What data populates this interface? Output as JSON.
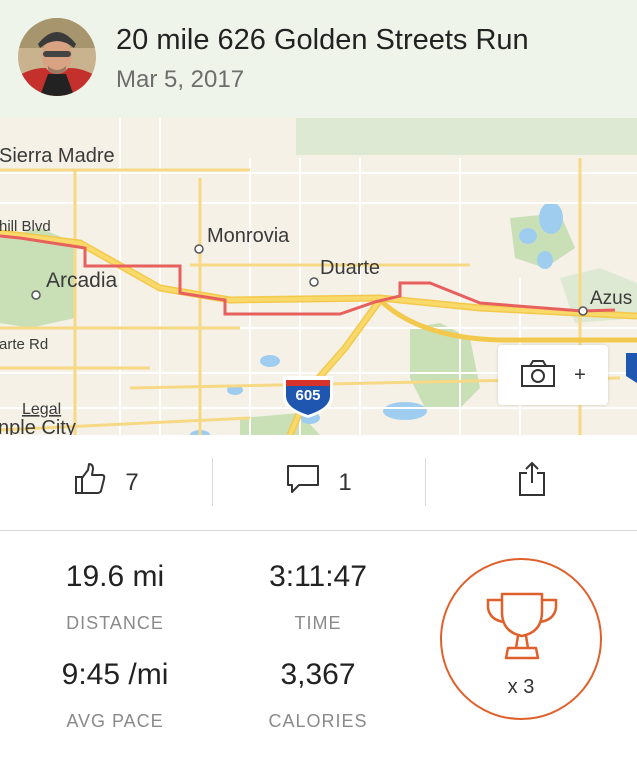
{
  "activity": {
    "title": "20 mile 626 Golden Streets Run",
    "date": "Mar 5, 2017"
  },
  "map": {
    "labels": {
      "sierra_madre": "Sierra Madre",
      "hill_blvd": "hill Blvd",
      "monrovia": "Monrovia",
      "duarte": "Duarte",
      "arcadia": "Arcadia",
      "azusa": "Azus",
      "arte_rd": "arte Rd",
      "legal": "Legal",
      "temple_city": "nple City",
      "i605": "605"
    },
    "route_color": "#e8605e"
  },
  "photo_button": {
    "plus": "+"
  },
  "actions": {
    "kudos_count": "7",
    "comment_count": "1"
  },
  "stats": {
    "distance": {
      "value": "19.6 mi",
      "label": "DISTANCE"
    },
    "time": {
      "value": "3:11:47",
      "label": "TIME"
    },
    "pace": {
      "value": "9:45 /mi",
      "label": "AVG PACE"
    },
    "calories": {
      "value": "3,367",
      "label": "CALORIES"
    }
  },
  "achievements": {
    "count": "x 3"
  },
  "colors": {
    "accent": "#e0602b",
    "header_bg": "#eff4ea",
    "map_bg": "#f5f1e7"
  }
}
